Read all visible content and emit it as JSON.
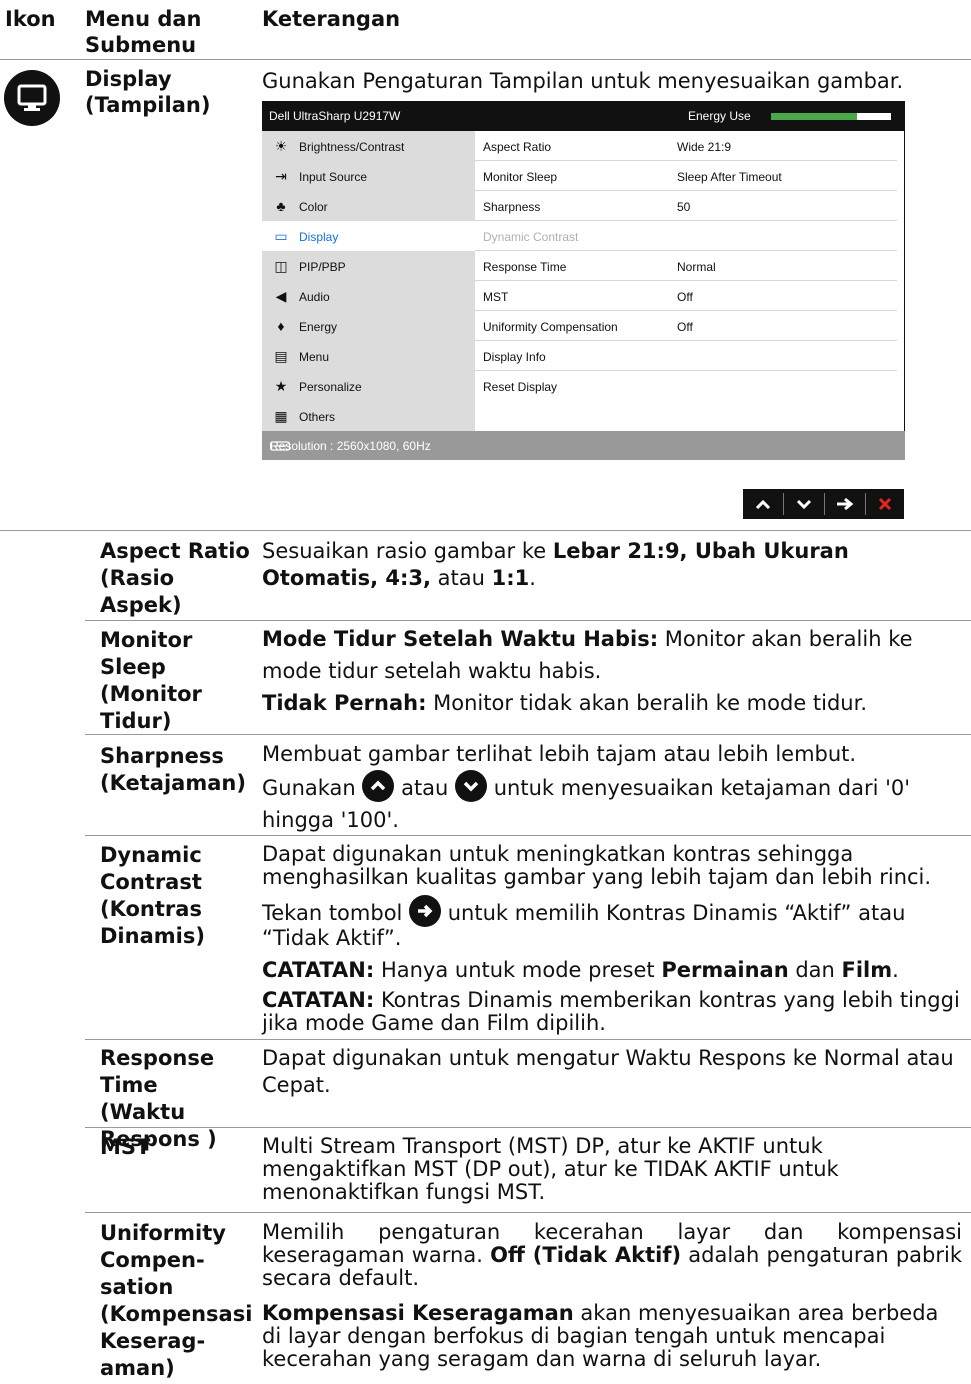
{
  "header": {
    "col_icon": "Ikon",
    "col_menu": "Menu dan Submenu",
    "col_desc": "Keterangan"
  },
  "display_section": {
    "icon": "monitor-icon",
    "name": "Display (Tampilan)",
    "desc": "Gunakan Pengaturan Tampilan untuk menyesuaikan gambar."
  },
  "osd": {
    "model": "Dell UltraSharp U2917W",
    "energy_label": "Energy Use",
    "energy_level": 0.72,
    "resolution": "Resolution : 2560x1080, 60Hz",
    "menu": [
      {
        "label": "Brightness/Contrast",
        "icon": "sun-icon",
        "glyph": "☀"
      },
      {
        "label": "Input Source",
        "icon": "input-icon",
        "glyph": "⇥"
      },
      {
        "label": "Color",
        "icon": "color-icon",
        "glyph": "♣"
      },
      {
        "label": "Display",
        "icon": "monitor-icon",
        "glyph": "▭"
      },
      {
        "label": "PIP/PBP",
        "icon": "pip-icon",
        "glyph": "◫"
      },
      {
        "label": "Audio",
        "icon": "speaker-icon",
        "glyph": "◀"
      },
      {
        "label": "Energy",
        "icon": "flame-icon",
        "glyph": "♦"
      },
      {
        "label": "Menu",
        "icon": "menu-icon",
        "glyph": "▤"
      },
      {
        "label": "Personalize",
        "icon": "star-icon",
        "glyph": "★"
      },
      {
        "label": "Others",
        "icon": "others-icon",
        "glyph": "▦"
      }
    ],
    "options": [
      {
        "label": "Aspect Ratio",
        "value": "Wide  21:9"
      },
      {
        "label": "Monitor Sleep",
        "value": "Sleep After Timeout"
      },
      {
        "label": "Sharpness",
        "value": "50"
      },
      {
        "label": "Dynamic Contrast",
        "value": ""
      },
      {
        "label": "Response Time",
        "value": "Normal"
      },
      {
        "label": "MST",
        "value": "Off"
      },
      {
        "label": "Uniformity Compensation",
        "value": "Off"
      },
      {
        "label": "Display Info",
        "value": ""
      },
      {
        "label": "Reset Display",
        "value": ""
      }
    ],
    "nav_buttons": {
      "up": "^",
      "down": "v",
      "next": "→",
      "exit": "✕"
    }
  },
  "rows": {
    "aspect": {
      "label": "Aspect Ratio (Rasio Aspek)",
      "t1": "Sesuaikan rasio gambar ke ",
      "b1": "Lebar 21:9, Ubah Ukuran Otomatis, 4:3,",
      "t2": " atau ",
      "b2": "1:1",
      "t3": "."
    },
    "sleep": {
      "label": "Monitor Sleep (Monitor Tidur)",
      "b1": "Mode Tidur Setelah Waktu Habis:",
      "t1": " Monitor akan beralih ke mode tidur setelah waktu habis.",
      "b2": "Tidak Pernah:",
      "t2": " Monitor tidak akan beralih ke mode tidur."
    },
    "sharp": {
      "label": "Sharpness (Ketajaman)",
      "p1": "Membuat gambar terlihat lebih tajam atau lebih lembut.",
      "t1": "Gunakan ",
      "t2": " atau ",
      "t3": " untuk menyesuaikan ketajaman dari '0' hingga '100'."
    },
    "dyn": {
      "label": "Dynamic Contrast (Kontras Dinamis)",
      "p1": "Dapat digunakan untuk meningkatkan kontras sehingga menghasilkan kualitas gambar yang lebih tajam dan lebih rinci.",
      "t1": "Tekan tombol ",
      "t2": " untuk memilih Kontras Dinamis “Aktif” atau “Tidak Aktif”.",
      "n1b": "CATATAN:",
      "n1t": " Hanya untuk mode preset ",
      "n1b2": "Permainan",
      "n1t2": " dan ",
      "n1b3": "Film",
      "n1t3": ".",
      "n2b": "CATATAN:",
      "n2t": " Kontras Dinamis memberikan kontras yang lebih tinggi jika mode Game dan Film dipilih."
    },
    "resp": {
      "label": "Response Time (Waktu Respons )",
      "p1": "Dapat digunakan untuk mengatur Waktu Respons ke Normal atau Cepat."
    },
    "mst": {
      "label": "MST",
      "p1": "Multi Stream Transport (MST) DP,  atur ke AKTIF untuk mengaktifkan MST (DP out), atur ke TIDAK AKTIF untuk menonaktifkan fungsi MST."
    },
    "uni": {
      "label": "Uniformity Compen-sation (Kompensasi Keserag-aman)",
      "t1": "Memilih pengaturan kecerahan layar dan kompensasi keseragaman warna. ",
      "b1": "Off (Tidak Aktif)",
      "t2": " adalah pengaturan pabrik secara default.",
      "b2": "Kompensasi Keseragaman",
      "t3": " akan menyesuaikan area berbeda di layar dengan berfokus di bagian tengah untuk mencapai kecerahan yang seragam dan warna di seluruh layar."
    }
  }
}
